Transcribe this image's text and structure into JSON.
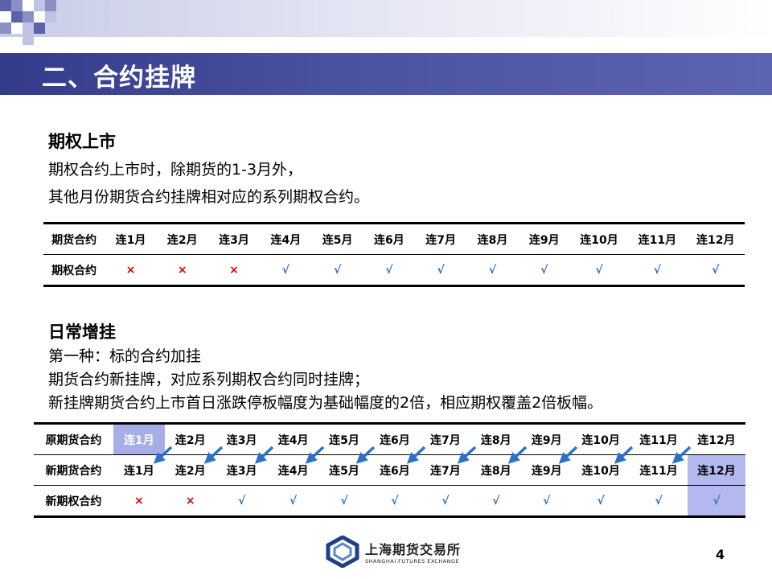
{
  "title": "二、合约挂牌",
  "section1": {
    "heading": "期权上市",
    "lines": [
      "期权合约上市时，除期货的1-3月外，",
      "其他月份期货合约挂牌相对应的系列期权合约。"
    ]
  },
  "table1": {
    "row_labels": [
      "期货合约",
      "期权合约"
    ],
    "months": [
      "连1月",
      "连2月",
      "连3月",
      "连4月",
      "连5月",
      "连6月",
      "连7月",
      "连8月",
      "连9月",
      "连10月",
      "连11月",
      "连12月"
    ],
    "marks": [
      "×",
      "×",
      "×",
      "√",
      "√",
      "√",
      "√",
      "√",
      "√",
      "√",
      "√",
      "√"
    ]
  },
  "section2": {
    "heading": "日常增挂",
    "lines": [
      "第一种：标的合约加挂",
      "期货合约新挂牌，对应系列期权合约同时挂牌；",
      "新挂牌期货合约上市首日涨跌停板幅度为基础幅度的2倍，相应期权覆盖2倍板幅。"
    ]
  },
  "table2": {
    "row_labels": [
      "原期货合约",
      "新期货合约",
      "新期权合约"
    ],
    "months": [
      "连1月",
      "连2月",
      "连3月",
      "连4月",
      "连5月",
      "连6月",
      "连7月",
      "连8月",
      "连9月",
      "连10月",
      "连11月",
      "连12月"
    ],
    "marks": [
      "×",
      "×",
      "√",
      "√",
      "√",
      "√",
      "√",
      "√",
      "√",
      "√",
      "√",
      "√"
    ],
    "highlight_color": "#a7aee6"
  },
  "logo": {
    "cn": "上海期货交易所",
    "en": "SHANGHAI FUTURES EXCHANGE"
  },
  "page_number": "4"
}
